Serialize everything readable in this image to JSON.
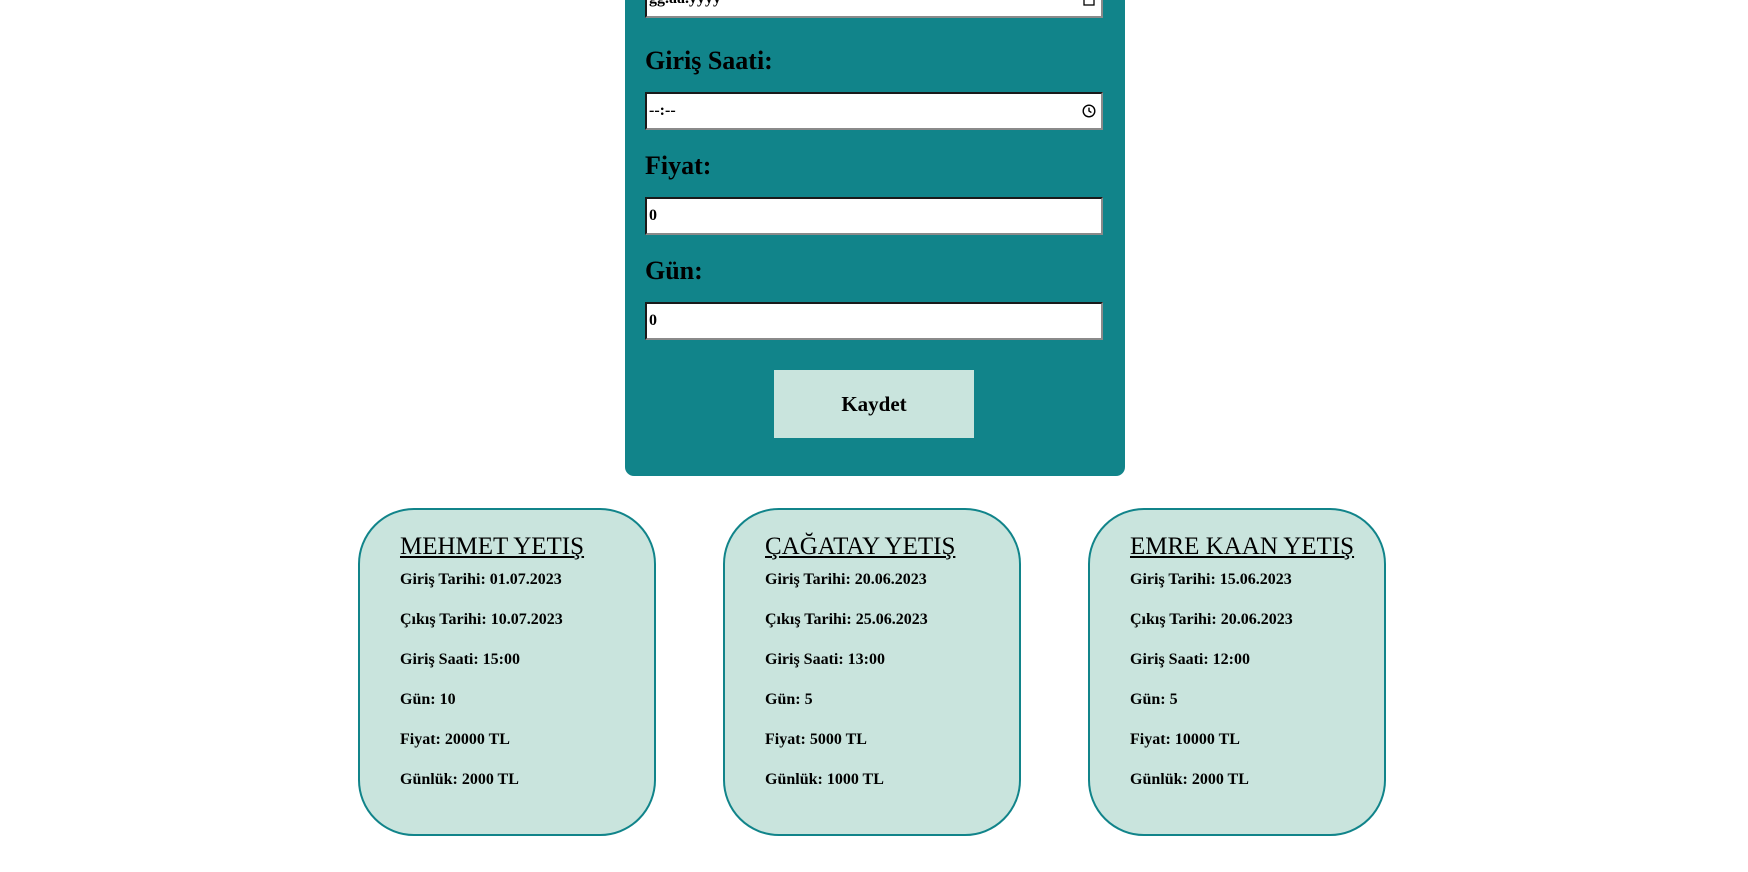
{
  "form": {
    "date_placeholder": "gg.aa.yyyy",
    "time_label": "Giriş Saati:",
    "time_placeholder": "--:--",
    "price_label": "Fiyat:",
    "price_value": "0",
    "days_label": "Gün:",
    "days_value": "0",
    "save_label": "Kaydet"
  },
  "colors": {
    "panel": "#11848a",
    "card_background": "#c9e4dd",
    "button_background": "#c9e4dd"
  },
  "cards": [
    {
      "name": "MEHMET YETIŞ",
      "checkin_date": "Giriş Tarihi: 01.07.2023",
      "checkout_date": "Çıkış Tarihi: 10.07.2023",
      "checkin_time": "Giriş Saati: 15:00",
      "days": "Gün: 10",
      "price": "Fiyat: 20000 TL",
      "daily": "Günlük: 2000 TL"
    },
    {
      "name": "ÇAĞATAY YETIŞ",
      "checkin_date": "Giriş Tarihi: 20.06.2023",
      "checkout_date": "Çıkış Tarihi: 25.06.2023",
      "checkin_time": "Giriş Saati: 13:00",
      "days": "Gün: 5",
      "price": "Fiyat: 5000 TL",
      "daily": "Günlük: 1000 TL"
    },
    {
      "name": "EMRE KAAN YETIŞ",
      "checkin_date": "Giriş Tarihi: 15.06.2023",
      "checkout_date": "Çıkış Tarihi: 20.06.2023",
      "checkin_time": "Giriş Saati: 12:00",
      "days": "Gün: 5",
      "price": "Fiyat: 10000 TL",
      "daily": "Günlük: 2000 TL"
    }
  ]
}
